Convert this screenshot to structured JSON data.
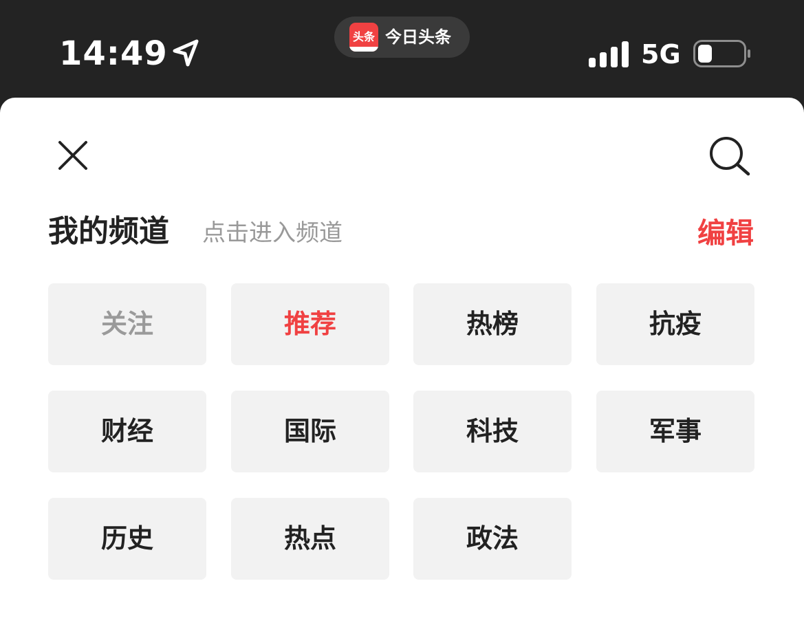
{
  "status_bar": {
    "time": "14:49",
    "island": {
      "logo_text": "头条",
      "app_name": "今日头条"
    },
    "network": "5G",
    "battery_level_fraction": 0.2
  },
  "header": {
    "title": "我的频道",
    "subtitle": "点击进入频道",
    "edit_label": "编辑"
  },
  "channels": [
    {
      "label": "关注",
      "state": "disabled"
    },
    {
      "label": "推荐",
      "state": "active"
    },
    {
      "label": "热榜",
      "state": "normal"
    },
    {
      "label": "抗疫",
      "state": "normal"
    },
    {
      "label": "财经",
      "state": "normal"
    },
    {
      "label": "国际",
      "state": "normal"
    },
    {
      "label": "科技",
      "state": "normal"
    },
    {
      "label": "军事",
      "state": "normal"
    },
    {
      "label": "历史",
      "state": "normal"
    },
    {
      "label": "热点",
      "state": "normal"
    },
    {
      "label": "政法",
      "state": "normal"
    }
  ],
  "colors": {
    "accent": "#f04142",
    "status_bar_bg": "#232323",
    "chip_bg": "#f2f2f2",
    "muted_text": "#999999"
  }
}
